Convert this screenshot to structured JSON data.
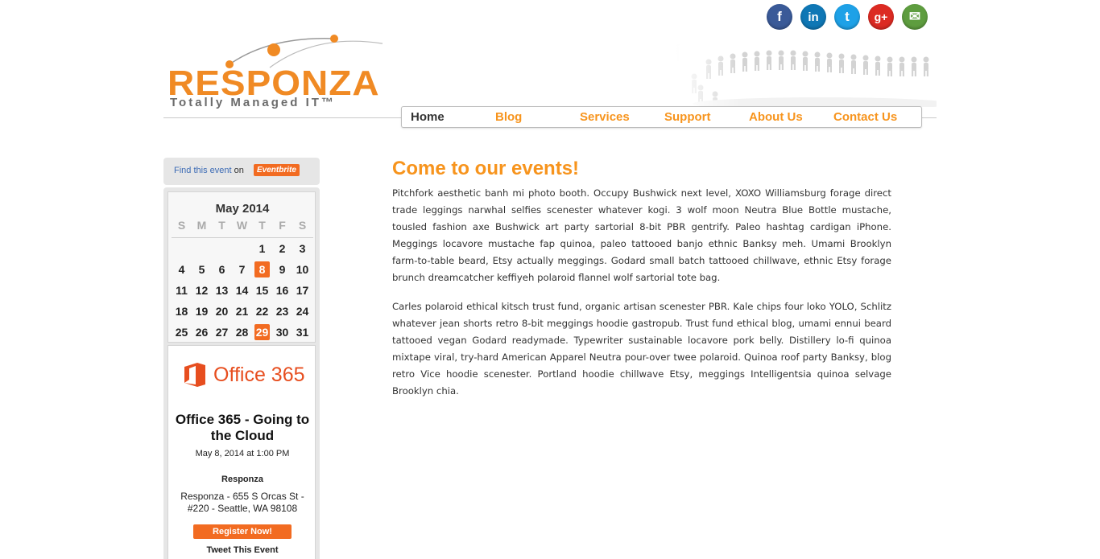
{
  "social": {
    "facebook": "f",
    "linkedin": "in",
    "twitter": "t",
    "googleplus": "g+",
    "email": "✉"
  },
  "logo": {
    "name": "RESPONZA",
    "tagline": "Totally Managed IT™"
  },
  "nav": {
    "items": [
      "Home",
      "Blog",
      "Services",
      "Support",
      "About Us",
      "Contact Us"
    ],
    "active": "Home"
  },
  "sidebar": {
    "eventbrite_prefix": "Find this event",
    "eventbrite_on": "on",
    "eventbrite_brand": "Eventbrite",
    "calendar": {
      "month": "May 2014",
      "dow": [
        "S",
        "M",
        "T",
        "W",
        "T",
        "F",
        "S"
      ],
      "weeks": [
        [
          "",
          "",
          "",
          "",
          "1",
          "2",
          "3"
        ],
        [
          "4",
          "5",
          "6",
          "7",
          "8",
          "9",
          "10"
        ],
        [
          "11",
          "12",
          "13",
          "14",
          "15",
          "16",
          "17"
        ],
        [
          "18",
          "19",
          "20",
          "21",
          "22",
          "23",
          "24"
        ],
        [
          "25",
          "26",
          "27",
          "28",
          "29",
          "30",
          "31"
        ]
      ],
      "event_days": [
        "8",
        "29"
      ]
    },
    "event": {
      "brand": "Office 365",
      "title": "Office 365 - Going to the Cloud",
      "date": "May 8, 2014 at 1:00 PM",
      "organizer": "Responza",
      "address": "Responza - 655 S Orcas St - #220 - Seattle, WA 98108",
      "register_label": "Register Now!",
      "tweet_label": "Tweet This Event"
    }
  },
  "main": {
    "title": "Come to our events!",
    "paragraphs": [
      "Pitchfork aesthetic banh mi photo booth. Occupy Bushwick next level, XOXO Williamsburg forage direct trade leggings narwhal selfies scenester whatever kogi. 3 wolf moon Neutra Blue Bottle mustache, tousled fashion axe Bushwick art party sartorial 8-bit PBR gentrify. Paleo hashtag cardigan iPhone. Meggings locavore mustache fap quinoa, paleo tattooed banjo ethnic Banksy meh. Umami Brooklyn farm-to-table beard, Etsy actually meggings. Godard small batch tattooed chillwave, ethnic Etsy forage brunch dreamcatcher keffiyeh polaroid flannel wolf sartorial tote bag.",
      "Carles polaroid ethical kitsch trust fund, organic artisan scenester PBR. Kale chips four loko YOLO, Schlitz whatever jean shorts retro 8-bit meggings hoodie gastropub. Trust fund ethical blog, umami ennui beard tattooed vegan Godard readymade. Typewriter sustainable locavore pork belly. Distillery lo-fi quinoa mixtape viral, try-hard American Apparel Neutra pour-over twee polaroid. Quinoa roof party Banksy, blog retro Vice hoodie scenester. Portland hoodie chillwave Etsy, meggings Intelligentsia quinoa selvage Brooklyn chia."
    ]
  },
  "colors": {
    "accent": "#f7941d",
    "eventbrite": "#f26b21",
    "office": "#e74e1f"
  }
}
